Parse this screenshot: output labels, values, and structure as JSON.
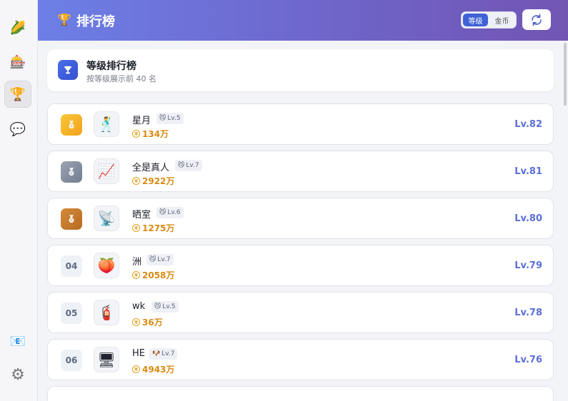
{
  "sidebar": {
    "items": [
      {
        "icon": "corn-icon",
        "glyph": "🌽"
      },
      {
        "icon": "slot-machine-icon",
        "glyph": "🎰"
      },
      {
        "icon": "trophy-icon",
        "glyph": "🏆"
      },
      {
        "icon": "chat-bubble-icon",
        "glyph": "💬"
      }
    ],
    "bottom": [
      {
        "icon": "mail-icon",
        "glyph": "📧"
      },
      {
        "icon": "gear-icon",
        "glyph": "⚙"
      }
    ]
  },
  "header": {
    "title": "排行榜",
    "toggle": {
      "options": [
        "等级",
        "金币"
      ],
      "selected": "等级"
    }
  },
  "section": {
    "title": "等级排行榜",
    "subtitle": "按等级展示前 40 名"
  },
  "rows": [
    {
      "rank": "",
      "medal": "gold",
      "avatar": "🕺",
      "name": "星月",
      "badge_icon": "😼",
      "badge": "Lv.5",
      "coins": "134万",
      "level": "Lv.82"
    },
    {
      "rank": "",
      "medal": "silver",
      "avatar": "📈",
      "name": "全是真人",
      "badge_icon": "😼",
      "badge": "Lv.7",
      "coins": "2922万",
      "level": "Lv.81"
    },
    {
      "rank": "",
      "medal": "bronze",
      "avatar": "📡",
      "name": "晒室",
      "badge_icon": "😼",
      "badge": "Lv.6",
      "coins": "1275万",
      "level": "Lv.80"
    },
    {
      "rank": "04",
      "medal": "",
      "avatar": "🍑",
      "name": "洲",
      "badge_icon": "😼",
      "badge": "Lv.7",
      "coins": "2058万",
      "level": "Lv.79"
    },
    {
      "rank": "05",
      "medal": "",
      "avatar": "🧯",
      "name": "wk",
      "badge_icon": "😼",
      "badge": "Lv.5",
      "coins": "36万",
      "level": "Lv.78"
    },
    {
      "rank": "06",
      "medal": "",
      "avatar": "🖥",
      "name": "HE",
      "badge_icon": "🐶",
      "badge": "Lv.7",
      "coins": "4943万",
      "level": "Lv.76"
    }
  ]
}
